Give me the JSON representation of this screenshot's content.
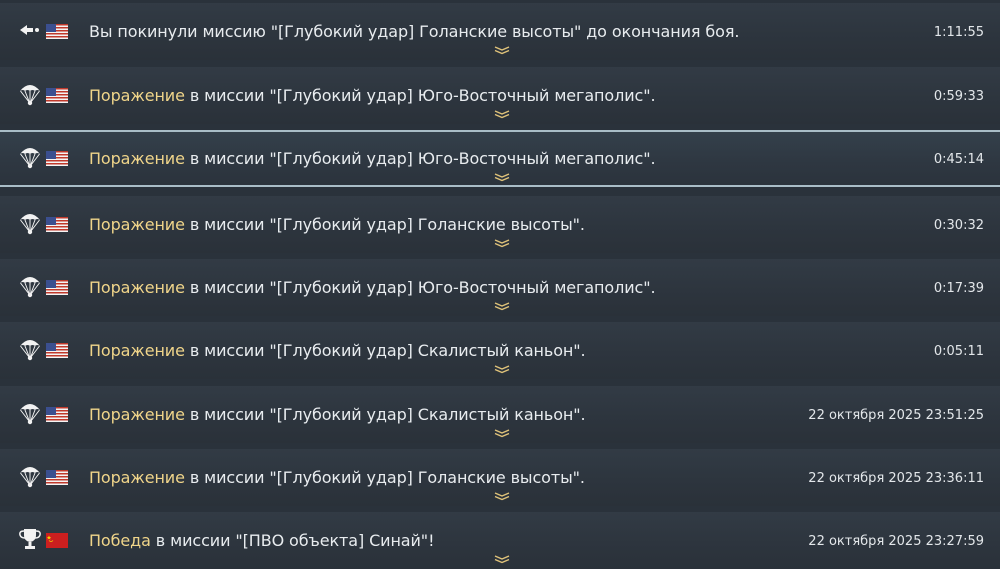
{
  "colors": {
    "background": "#2a323b",
    "row": "#2d353e",
    "row_selected_border": "#a9bdc7",
    "text": "#e8ecef",
    "status_text": "#f0d58a"
  },
  "entries": [
    {
      "icon": "leave-arrow-icon",
      "flag": "usa-flag-icon",
      "status": "",
      "message": "Вы покинули миссию \"[Глубокий удар] Голанские высоты\" до окончания боя.",
      "time": "1:11:55",
      "selected": false
    },
    {
      "icon": "parachute-icon",
      "flag": "usa-flag-icon",
      "status": "Поражение",
      "message": " в миссии \"[Глубокий удар] Юго-Восточный мегаполис\".",
      "time": "0:59:33",
      "selected": false
    },
    {
      "icon": "parachute-icon",
      "flag": "usa-flag-icon",
      "status": "Поражение",
      "message": " в миссии \"[Глубокий удар] Юго-Восточный мегаполис\".",
      "time": "0:45:14",
      "selected": true
    },
    {
      "icon": "parachute-icon",
      "flag": "usa-flag-icon",
      "status": "Поражение",
      "message": " в миссии \"[Глубокий удар] Голанские высоты\".",
      "time": "0:30:32",
      "selected": false
    },
    {
      "icon": "parachute-icon",
      "flag": "usa-flag-icon",
      "status": "Поражение",
      "message": " в миссии \"[Глубокий удар] Юго-Восточный мегаполис\".",
      "time": "0:17:39",
      "selected": false
    },
    {
      "icon": "parachute-icon",
      "flag": "usa-flag-icon",
      "status": "Поражение",
      "message": " в миссии \"[Глубокий удар] Скалистый каньон\".",
      "time": "0:05:11",
      "selected": false
    },
    {
      "icon": "parachute-icon",
      "flag": "usa-flag-icon",
      "status": "Поражение",
      "message": " в миссии \"[Глубокий удар] Скалистый каньон\".",
      "time": "22 октября 2025 23:51:25",
      "selected": false
    },
    {
      "icon": "parachute-icon",
      "flag": "usa-flag-icon",
      "status": "Поражение",
      "message": " в миссии \"[Глубокий удар] Голанские высоты\".",
      "time": "22 октября 2025 23:36:11",
      "selected": false
    },
    {
      "icon": "trophy-icon",
      "flag": "ussr-flag-icon",
      "status": "Победа",
      "message": " в миссии \"[ПВО объекта] Синай\"!",
      "time": "22 октября 2025 23:27:59",
      "selected": false
    }
  ]
}
